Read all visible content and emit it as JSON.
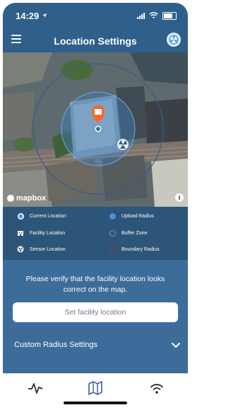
{
  "status": {
    "time": "14:29"
  },
  "header": {
    "title": "Location Settings"
  },
  "map": {
    "attribution": "mapbox"
  },
  "legend": {
    "items": [
      {
        "label": "Current Location"
      },
      {
        "label": "Upload Radius"
      },
      {
        "label": "Facility Location"
      },
      {
        "label": "Buffer Zone"
      },
      {
        "label": "Sensor Location"
      },
      {
        "label": "Boundary Radius"
      }
    ]
  },
  "panel": {
    "message": "Please verify that the facility location looks correct on the map.",
    "set_button": "Set facility location",
    "custom_radius": "Custom Radius Settings"
  },
  "colors": {
    "header": "#2f5f8b",
    "legend_bg": "#2d557a",
    "panel_bg": "#3d6c9a",
    "facility_marker": "#ef6a2c",
    "upload_radius": "#4d8fd6",
    "buffer_zone": "#365e88",
    "boundary_radius": "#9b3a45"
  },
  "tabs": [
    {
      "name": "activity-icon"
    },
    {
      "name": "map-icon"
    },
    {
      "name": "wifi-icon"
    }
  ]
}
